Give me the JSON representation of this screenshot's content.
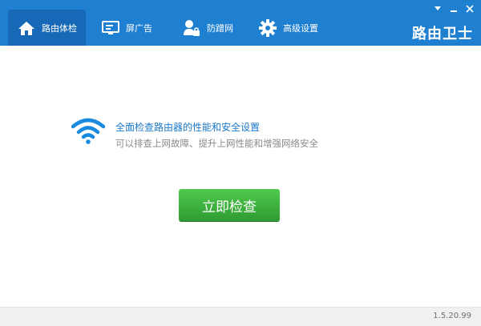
{
  "tabs": [
    {
      "label": "路由体检",
      "icon": "home-icon",
      "active": true
    },
    {
      "label": "屏广告",
      "icon": "monitor-icon",
      "active": false
    },
    {
      "label": "防蹭网",
      "icon": "user-lock-icon",
      "active": false
    },
    {
      "label": "高级设置",
      "icon": "gear-icon",
      "active": false
    }
  ],
  "brand": "路由卫士",
  "window_controls": [
    "dropdown-icon",
    "minimize-icon",
    "close-icon"
  ],
  "main": {
    "headline": "全面检查路由器的性能和安全设置",
    "subline": "可以排查上网故障、提升上网性能和增强网络安全",
    "check_button": "立即检查",
    "wifi_icon": "wifi-icon"
  },
  "status": {
    "version": "1.5.20.99"
  },
  "colors": {
    "topbar": "#1f7fd0",
    "active_tab": "#1769b7",
    "button": "#3aa83c",
    "headline": "#1b78c9"
  }
}
